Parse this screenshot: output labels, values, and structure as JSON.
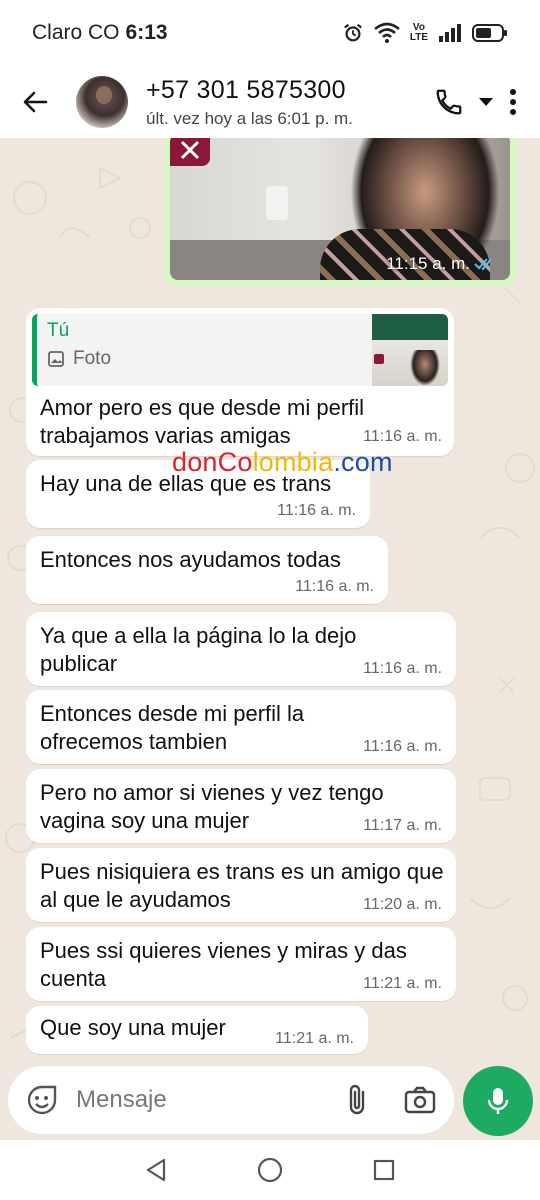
{
  "status_bar": {
    "carrier": "Claro CO",
    "time": "6:13",
    "volte_top": "Vo",
    "volte_bottom": "LTE"
  },
  "header": {
    "contact_name": "+57 301 5875300",
    "last_seen": "últ. vez hoy a las 6:01 p. m.",
    "icons": [
      "back-arrow-icon",
      "avatar",
      "phone-icon",
      "dropdown-icon",
      "more-vert-icon"
    ]
  },
  "photo_message": {
    "time": "11:15 a. m.",
    "read_color": "#53bdeb"
  },
  "quoted_reply": {
    "author": "Tú",
    "type_label": "Foto",
    "text": "Amor pero es que desde mi perfil trabajamos varias amigas",
    "time": "11:16 a. m."
  },
  "messages": [
    {
      "text": "Hay una de ellas que es trans",
      "time": "11:16 a. m."
    },
    {
      "text": "Entonces nos ayudamos todas",
      "time": "11:16 a. m."
    },
    {
      "text": "Ya que a ella la página lo la dejo publicar",
      "time": "11:16 a. m."
    },
    {
      "text": "Entonces desde mi perfil la ofrecemos tambien",
      "time": "11:16 a. m."
    },
    {
      "text": "Pero no amor si vienes y vez tengo vagina soy una mujer",
      "time": "11:17 a. m."
    },
    {
      "text": "Pues nisiquiera es trans es un amigo que al que le ayudamos",
      "time": "11:20 a. m."
    },
    {
      "text": "Pues ssi quieres vienes y miras y das cuenta",
      "time": "11:21 a. m."
    },
    {
      "text": "Que soy una mujer",
      "time": "11:21 a. m."
    }
  ],
  "watermark": {
    "part1": "donCo",
    "part2": "lombia",
    "part3": ".com"
  },
  "composer": {
    "placeholder": "Mensaje",
    "accent": "#1daa61"
  },
  "nav": {
    "icons": [
      "back-triangle-icon",
      "home-circle-icon",
      "recents-square-icon"
    ]
  }
}
